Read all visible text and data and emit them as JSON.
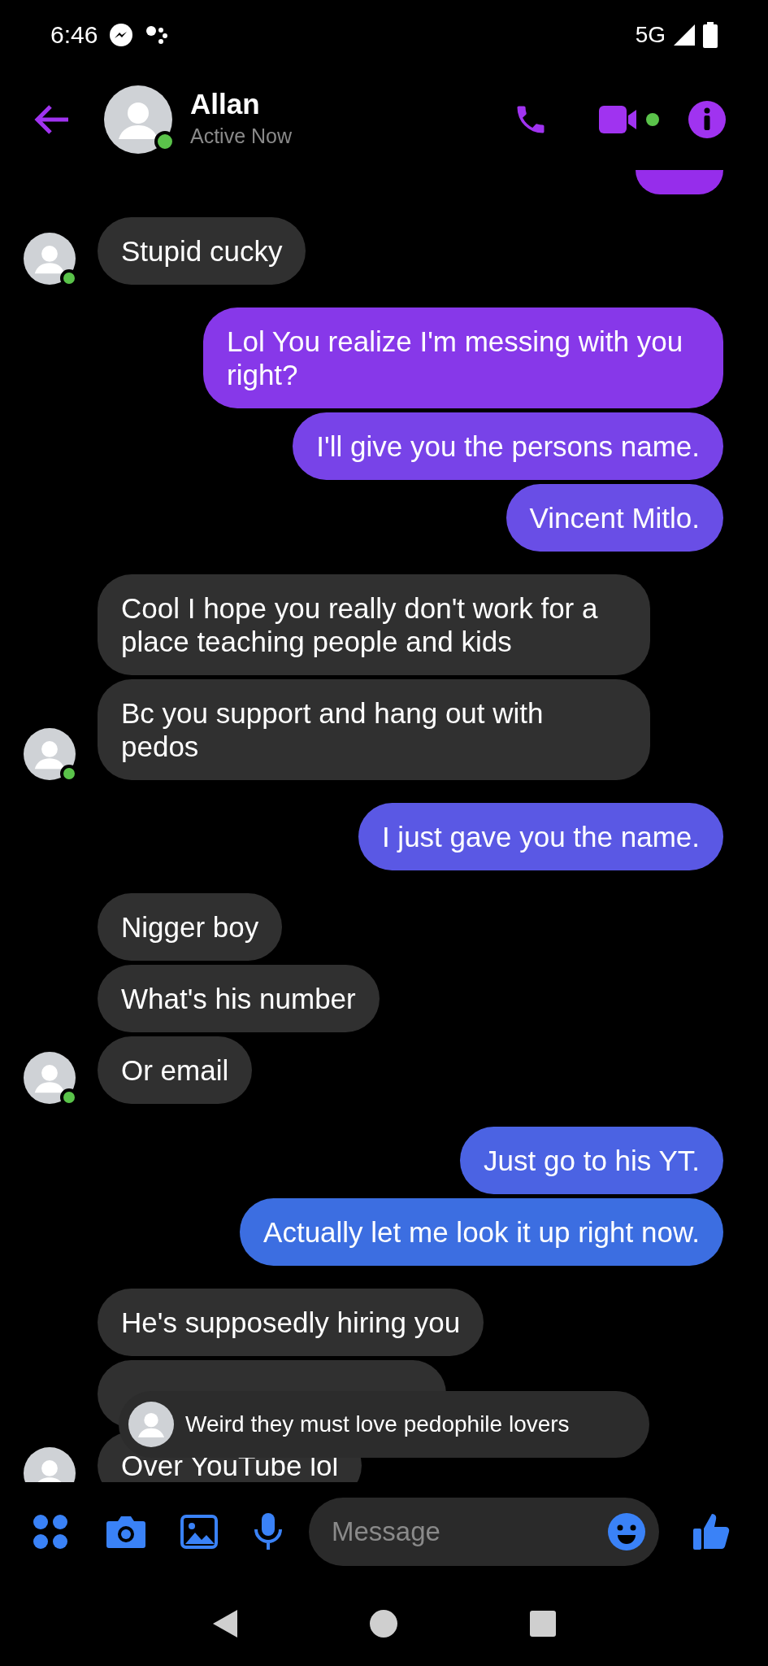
{
  "status_bar": {
    "time": "6:46",
    "network": "5G"
  },
  "header": {
    "name": "Allan",
    "status": "Active Now",
    "online": true
  },
  "groups": [
    {
      "kind": "outgoing",
      "messages": [
        {
          "kind": "stub"
        }
      ]
    },
    {
      "kind": "incoming",
      "online": true,
      "messages": [
        {
          "kind": "text",
          "text": "Stupid cucky"
        }
      ]
    },
    {
      "kind": "outgoing",
      "messages": [
        {
          "kind": "text",
          "text": "Lol You realize I'm messing with you right?"
        },
        {
          "kind": "text",
          "text": "I'll give you the persons name."
        },
        {
          "kind": "text",
          "text": "Vincent Mitlo."
        }
      ]
    },
    {
      "kind": "incoming",
      "online": true,
      "messages": [
        {
          "kind": "text",
          "text": "Cool I hope you really don't work for a place teaching people and kids"
        },
        {
          "kind": "text",
          "text": "Bc you support and hang out with pedos"
        }
      ]
    },
    {
      "kind": "outgoing",
      "messages": [
        {
          "kind": "text",
          "text": "I just gave you the name."
        }
      ]
    },
    {
      "kind": "incoming",
      "online": true,
      "messages": [
        {
          "kind": "text",
          "text": "Nigger boy"
        },
        {
          "kind": "text",
          "text": "What's his number"
        },
        {
          "kind": "text",
          "text": "Or email"
        }
      ]
    },
    {
      "kind": "outgoing",
      "messages": [
        {
          "kind": "text",
          "text": "Just go to his YT."
        },
        {
          "kind": "text",
          "text": "Actually let me look it up right now."
        }
      ]
    },
    {
      "kind": "incoming",
      "messages": [
        {
          "kind": "text",
          "text": "He's supposedly hiring you"
        },
        {
          "kind": "stub"
        },
        {
          "kind": "text",
          "text": "Over YouTube lol"
        }
      ]
    }
  ],
  "toast": {
    "text": "Weird they must love pedophile lovers"
  },
  "composer": {
    "placeholder": "Message"
  }
}
